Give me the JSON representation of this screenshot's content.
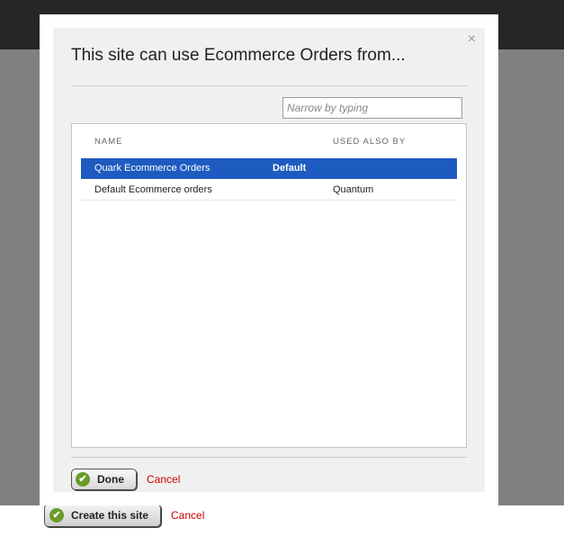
{
  "background": {
    "create_button_label": "Create this site",
    "cancel_label": "Cancel"
  },
  "dialog": {
    "title": "This site can use Ecommerce Orders from...",
    "close_symbol": "×",
    "filter_placeholder": "Narrow by typing",
    "columns": {
      "name": "NAME",
      "used_also_by": "USED ALSO BY"
    },
    "rows": [
      {
        "name": "Quark Ecommerce Orders",
        "badge": "Default",
        "used_by": "",
        "selected": true
      },
      {
        "name": "Default Ecommerce orders",
        "badge": "",
        "used_by": "Quantum",
        "selected": false
      }
    ],
    "done_label": "Done",
    "cancel_label": "Cancel"
  },
  "colors": {
    "selected_row": "#1e5bc0",
    "cancel_link": "#cc0000",
    "check_icon": "#6a9b28"
  },
  "icons": {
    "done": "check-icon",
    "create": "check-icon",
    "close": "close-icon"
  }
}
